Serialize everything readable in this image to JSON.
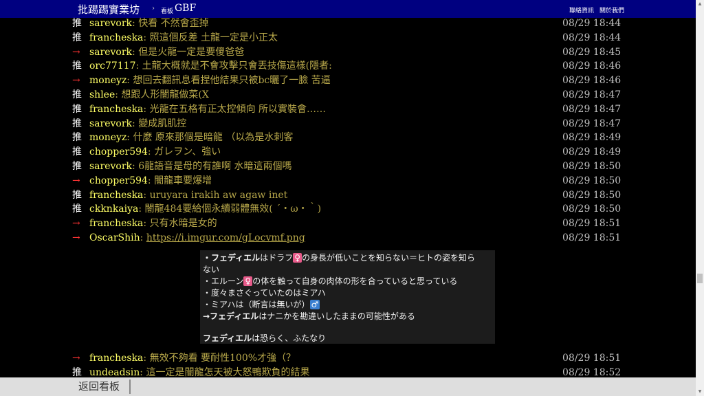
{
  "topbar": {
    "brand": "批踢踢實業坊",
    "separator": "›",
    "board_prefix": "看板",
    "board_name": "GBF",
    "links": [
      "聯絡資訊",
      "關於我們"
    ]
  },
  "pushes": [
    {
      "tag": "推",
      "user": "sarevork",
      "content": ": 快看 不然會歪掉",
      "time": "08/29 18:44"
    },
    {
      "tag": "推",
      "user": "francheska",
      "content": ": 照這個反差 土龍一定是小正太",
      "time": "08/29 18:44"
    },
    {
      "tag": "→",
      "user": "sarevork",
      "content": ": 但是火龍一定是要傻爸爸",
      "time": "08/29 18:45"
    },
    {
      "tag": "推",
      "user": "orc77117",
      "content": ": 土龍大概就是不會攻擊只會丟技傷這樣(隱者:",
      "time": "08/29 18:46"
    },
    {
      "tag": "→",
      "user": "moneyz",
      "content": ": 想回去翻訊息看捏他結果只被bc曬了一臉 苦逼",
      "time": "08/29 18:46"
    },
    {
      "tag": "推",
      "user": "shlee",
      "content": ": 想跟人形闇龍做菜(X",
      "time": "08/29 18:47"
    },
    {
      "tag": "推",
      "user": "francheska",
      "content": ": 光龍在五格有正太控傾向 所以實裝會……",
      "time": "08/29 18:47"
    },
    {
      "tag": "推",
      "user": "sarevork",
      "content": ": 變成肌肌控",
      "time": "08/29 18:47"
    },
    {
      "tag": "推",
      "user": "moneyz",
      "content": ": 什麼 原來那個是暗龍 （以為是水刺客",
      "time": "08/29 18:49"
    },
    {
      "tag": "推",
      "user": "chopper594",
      "content": ": ガレヲン、強い",
      "time": "08/29 18:49"
    },
    {
      "tag": "推",
      "user": "sarevork",
      "content": ": 6龍語音是母的有誰啊 水暗這兩個嗎",
      "time": "08/29 18:50"
    },
    {
      "tag": "→",
      "user": "chopper594",
      "content": ": 闇龍車要爆增",
      "time": "08/29 18:50"
    },
    {
      "tag": "推",
      "user": "francheska",
      "content": ": uruyara irakih aw agaw inet",
      "time": "08/29 18:50"
    },
    {
      "tag": "推",
      "user": "ckknkaiya",
      "content": ": 闇龍484要給個永續弱體無效( ´・ω・｀)",
      "time": "08/29 18:50"
    },
    {
      "tag": "→",
      "user": "francheska",
      "content": ": 只有水暗是女的",
      "time": "08/29 18:51"
    },
    {
      "tag": "→",
      "user": "OscarShih",
      "content": ": ",
      "link": "https://i.imgur.com/gLocvmf.png",
      "time": "08/29 18:51"
    }
  ],
  "image_text": {
    "line1_bold": "・フェディエル",
    "line1_a": "はドラフ",
    "line1_b": "の身長が低いことを知らない＝ヒトの姿を知ら",
    "line2": "ない",
    "line3_a": "・エルーン",
    "line3_b": "の体を触って自身の肉体の形を合っていると思っている",
    "line4": "・度々まさぐっていたのはミアハ",
    "line5": "・ミアハは（断言は無いが）",
    "line6_bold": "→フェディエル",
    "line6_rest": "はナニかを勘違いしたままの可能性がある",
    "line7_bold": "フェディエル",
    "line7_rest": "は恐らく、ふたなり",
    "female_symbol": "♀",
    "male_symbol": "♂"
  },
  "pushes_after": [
    {
      "tag": "→",
      "user": "francheska",
      "content": ": 無效不夠看 要耐性100%才強（？",
      "time": "08/29 18:51"
    },
    {
      "tag": "推",
      "user": "undeadsin",
      "content": ": 這一定是闇龍怎天被大怒鴨欺負的結果",
      "time": "08/29 18:52"
    }
  ],
  "bottombar": {
    "back_label": "返回看板"
  },
  "colors": {
    "topbar_bg": "#000080",
    "tag_push": "#ffffff",
    "tag_arrow": "#ff3333",
    "user": "#ffff66",
    "content": "#b8a84a"
  }
}
